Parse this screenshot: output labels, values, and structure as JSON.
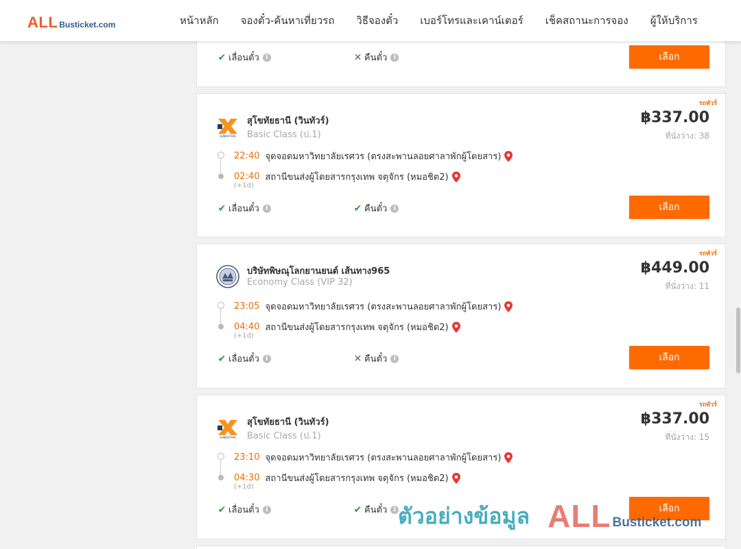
{
  "brand": {
    "logo_main": "ALL",
    "logo_rest": "Busticket.com"
  },
  "nav": [
    "หน้าหลัก",
    "จองตั๋ว-ค้นหาเที่ยวรถ",
    "วิธีจองตั๋ว",
    "เบอร์โทรและเคาน์เตอร์",
    "เช็คสถานะการจอง",
    "ผู้ให้บริการ"
  ],
  "colors": {
    "accent": "#ff6a00",
    "time": "#ef6c00",
    "check": "#2e9e3a",
    "pin": "#e53935"
  },
  "top_card": {
    "opt_postpone": "เลื่อนตั๋ว",
    "postpone_ok": true,
    "opt_refund": "คืนตั๋ว",
    "refund_ok": false,
    "select": "เลือก"
  },
  "trips": [
    {
      "tag": "รถทัวร์",
      "logo_icon": "wintour-logo-icon",
      "operator": "สุโขทัยธานี (วินทัวร์)",
      "bus_class": "Basic Class (ป.1)",
      "price": "฿337.00",
      "seats": "ที่นั่งว่าง: 38",
      "depart_time": "22:40",
      "depart_place": "จุดจอดมหาวิทยาลัยเรศวร (ตรงสะพานลอยศาลาพักผู้โดยสาร)",
      "arrive_time": "02:40",
      "arrive_place": "สถานีขนส่งผู้โดยสารกรุงเทพ จตุจักร (หมอชิต2)",
      "next_day": "(+1d)",
      "opt_postpone": "เลื่อนตั๋ว",
      "postpone_ok": true,
      "opt_refund": "คืนตั๋ว",
      "refund_ok": true,
      "select": "เลือก"
    },
    {
      "tag": "รถทัวร์",
      "logo_icon": "phitsanulok-seal-icon",
      "operator": "บริษัทพิษณุโลกยานยนต์ เส้นทาง965",
      "bus_class": "Economy Class (VIP 32)",
      "price": "฿449.00",
      "seats": "ที่นั่งว่าง: 11",
      "depart_time": "23:05",
      "depart_place": "จุดจอดมหาวิทยาลัยเรศวร (ตรงสะพานลอยศาลาพักผู้โดยสาร)",
      "arrive_time": "04:40",
      "arrive_place": "สถานีขนส่งผู้โดยสารกรุงเทพ จตุจักร (หมอชิต2)",
      "next_day": "(+1d)",
      "opt_postpone": "เลื่อนตั๋ว",
      "postpone_ok": true,
      "opt_refund": "คืนตั๋ว",
      "refund_ok": false,
      "select": "เลือก"
    },
    {
      "tag": "รถทัวร์",
      "logo_icon": "wintour-logo-icon",
      "operator": "สุโขทัยธานี (วินทัวร์)",
      "bus_class": "Basic Class (ป.1)",
      "price": "฿337.00",
      "seats": "ที่นั่งว่าง: 15",
      "depart_time": "23:10",
      "depart_place": "จุดจอดมหาวิทยาลัยเรศวร (ตรงสะพานลอยศาลาพักผู้โดยสาร)",
      "arrive_time": "04:30",
      "arrive_place": "สถานีขนส่งผู้โดยสารกรุงเทพ จตุจักร (หมอชิต2)",
      "next_day": "(+1d)",
      "opt_postpone": "เลื่อนตั๋ว",
      "postpone_ok": true,
      "opt_refund": "คืนตั๋ว",
      "refund_ok": true,
      "select": "เลือก"
    }
  ],
  "watermark": {
    "thai": "ตัวอย่างข้อมูล",
    "all": "ALL",
    "rest": "Busticket.com"
  }
}
